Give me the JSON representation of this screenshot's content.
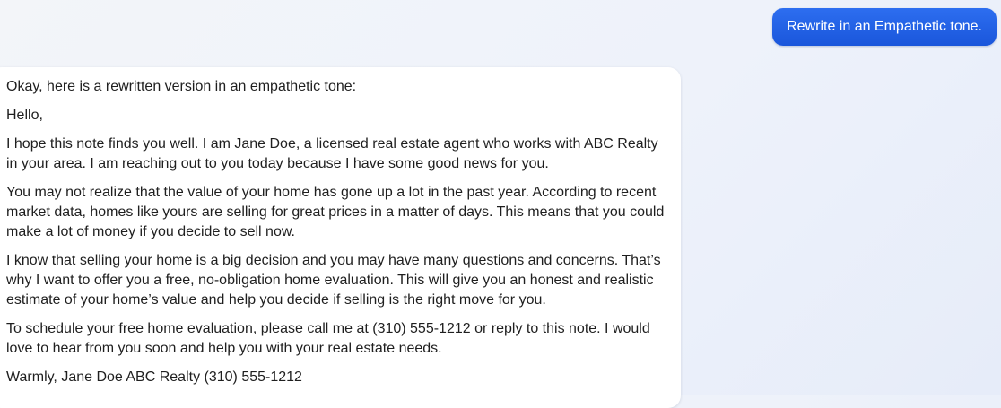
{
  "user_message": {
    "text": "Rewrite in an Empathetic tone."
  },
  "assistant_message": {
    "intro": "Okay, here is a rewritten version in an empathetic tone:",
    "greeting": "Hello,",
    "paragraphs": [
      "I hope this note finds you well. I am Jane Doe, a licensed real estate agent who works with ABC Realty in your area. I am reaching out to you today because I have some good news for you.",
      "You may not realize that the value of your home has gone up a lot in the past year. According to recent market data, homes like yours are selling for great prices in a matter of days. This means that you could make a lot of money if you decide to sell now.",
      "I know that selling your home is a big decision and you may have many questions and concerns. That’s why I want to offer you a free, no-obligation home evaluation. This will give you an honest and realistic estimate of your home’s value and help you decide if selling is the right move for you.",
      "To schedule your free home evaluation, please call me at (310) 555-1212 or reply to this note. I would love to hear from you soon and help you with your real estate needs."
    ],
    "closing": "Warmly, Jane Doe ABC Realty (310) 555-1212"
  },
  "colors": {
    "user_bubble": "#1a56db",
    "assistant_bubble": "#ffffff",
    "text": "#1f1f1f"
  }
}
